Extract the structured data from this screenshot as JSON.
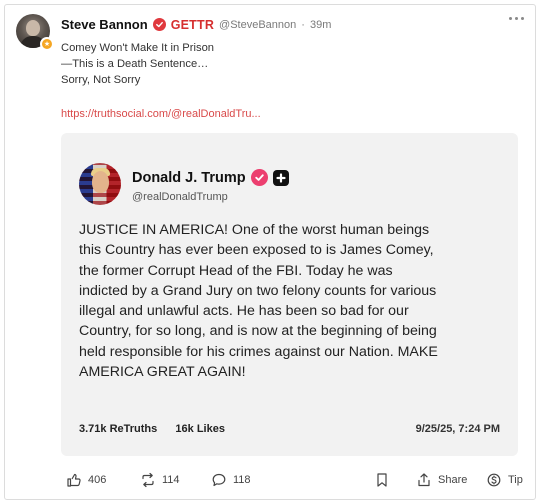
{
  "post": {
    "author": "Steve Bannon",
    "brand": "GETTR",
    "handle": "@SteveBannon",
    "separator": "·",
    "time": "39m",
    "lines": [
      "Comey Won't Make It in Prison",
      "—This is a Death Sentence…",
      "Sorry, Not Sorry"
    ],
    "link": "https://truthsocial.com/@realDonaldTru..."
  },
  "embed": {
    "name": "Donald J. Trump",
    "handle": "@realDonaldTrump",
    "body_lines": [
      "JUSTICE IN AMERICA! One of the worst human beings",
      "this Country has ever been exposed to is James Comey,",
      "the former Corrupt Head of the FBI. Today he was",
      "indicted by a Grand Jury on two felony counts for various",
      "illegal and unlawful acts. He has been so bad for our",
      "Country, for so long, and is now at the beginning of being",
      "held responsible for his crimes against our Nation. MAKE",
      "AMERICA GREAT AGAIN!"
    ],
    "retruths_count": "3.71k",
    "retruths_label": "ReTruths",
    "likes_count": "16k",
    "likes_label": "Likes",
    "date": "9/25/25, 7:24 PM"
  },
  "actions": {
    "likes": "406",
    "reposts": "114",
    "comments": "118",
    "share_label": "Share",
    "tip_label": "Tip"
  },
  "icons": [
    "verified-icon",
    "more-icon",
    "plus-badge-icon",
    "like-icon",
    "repost-icon",
    "comment-icon",
    "bookmark-icon",
    "share-icon",
    "tip-icon"
  ],
  "colors": {
    "brand_red": "#d62f2f",
    "link": "#d94a4a",
    "card_bg": "#f2f2f2",
    "embed_verified": "#ec3f6f"
  }
}
